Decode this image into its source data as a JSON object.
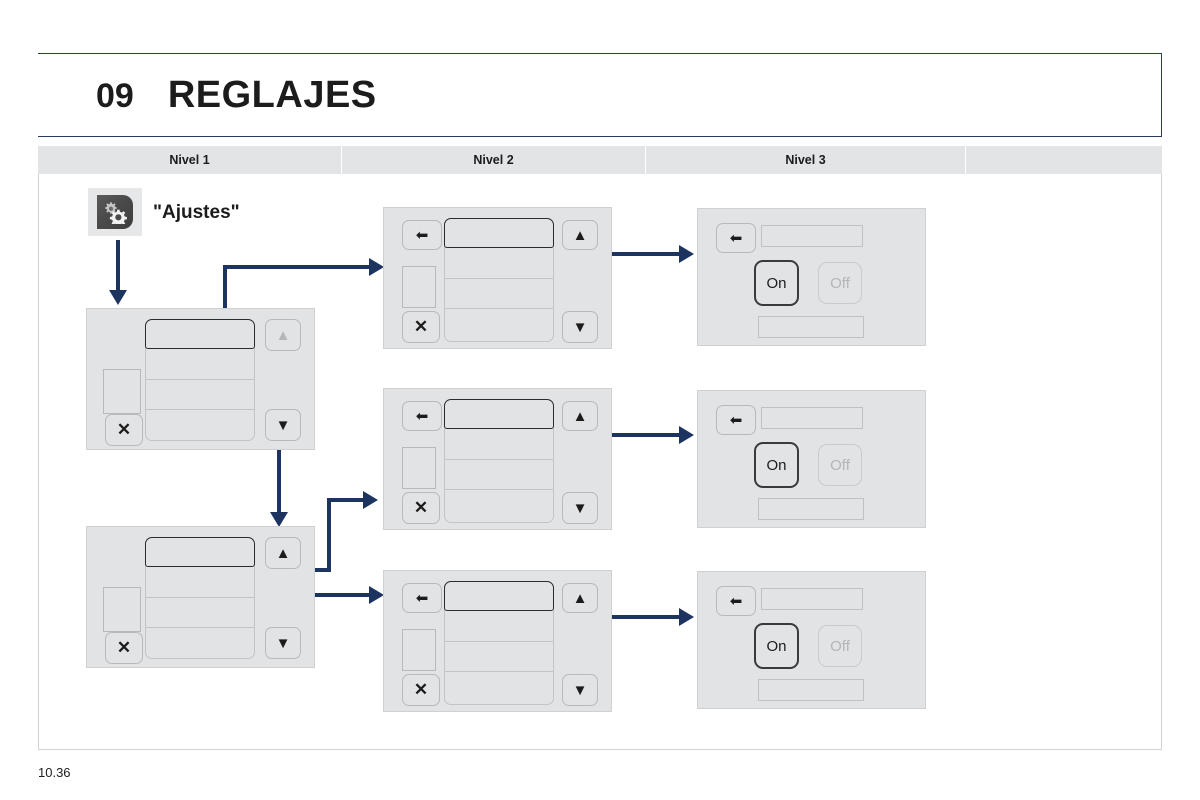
{
  "page": {
    "chapter_number": "09",
    "chapter_title": "REGLAJES",
    "footer_page": "10.36"
  },
  "level_headers": [
    {
      "label": "Nivel 1"
    },
    {
      "label": "Nivel 2"
    },
    {
      "label": "Nivel 3"
    },
    {
      "label": ""
    }
  ],
  "entry": {
    "icon": "settings-gears-icon",
    "caption": "\"Ajustes\""
  },
  "colors": {
    "accent_navy": "#1d3461",
    "header_border": "#2a3b63",
    "screen_bg": "#e2e3e5",
    "screen_border": "#cfd0d2",
    "levelbar_bg": "#e3e4e6",
    "selected_outline": "#2b2b2b",
    "disabled_text": "#b4b5b7"
  },
  "panels": {
    "level1": [
      {
        "id": "level1-panel-1",
        "buttons": [
          {
            "name": "close-button",
            "glyph": "✕"
          },
          {
            "name": "scroll-up-button",
            "glyph": "▲",
            "state": "disabled"
          },
          {
            "name": "scroll-down-button",
            "glyph": "▼",
            "state": "enabled"
          }
        ],
        "list_rows": 4,
        "selected_row": 1
      },
      {
        "id": "level1-panel-2",
        "buttons": [
          {
            "name": "close-button",
            "glyph": "✕"
          },
          {
            "name": "scroll-up-button",
            "glyph": "▲",
            "state": "enabled"
          },
          {
            "name": "scroll-down-button",
            "glyph": "▼",
            "state": "enabled"
          }
        ],
        "list_rows": 4,
        "selected_row": 1
      }
    ],
    "level2": [
      {
        "id": "level2-panel-1",
        "buttons": [
          {
            "name": "back-button",
            "glyph": "⬅"
          },
          {
            "name": "close-button",
            "glyph": "✕"
          },
          {
            "name": "scroll-up-button",
            "glyph": "▲"
          },
          {
            "name": "scroll-down-button",
            "glyph": "▼"
          }
        ],
        "list_rows": 4,
        "selected_row": 1
      },
      {
        "id": "level2-panel-2",
        "buttons": [
          {
            "name": "back-button",
            "glyph": "⬅"
          },
          {
            "name": "close-button",
            "glyph": "✕"
          },
          {
            "name": "scroll-up-button",
            "glyph": "▲"
          },
          {
            "name": "scroll-down-button",
            "glyph": "▼"
          }
        ],
        "list_rows": 4,
        "selected_row": 1
      },
      {
        "id": "level2-panel-3",
        "buttons": [
          {
            "name": "back-button",
            "glyph": "⬅"
          },
          {
            "name": "close-button",
            "glyph": "✕"
          },
          {
            "name": "scroll-up-button",
            "glyph": "▲"
          },
          {
            "name": "scroll-down-button",
            "glyph": "▼"
          }
        ],
        "list_rows": 4,
        "selected_row": 1
      }
    ],
    "level3": [
      {
        "id": "level3-panel-1",
        "back_glyph": "⬅",
        "on_label": "On",
        "off_label": "Off",
        "selected": "On"
      },
      {
        "id": "level3-panel-2",
        "back_glyph": "⬅",
        "on_label": "On",
        "off_label": "Off",
        "selected": "On"
      },
      {
        "id": "level3-panel-3",
        "back_glyph": "⬅",
        "on_label": "On",
        "off_label": "Off",
        "selected": "On"
      }
    ]
  }
}
